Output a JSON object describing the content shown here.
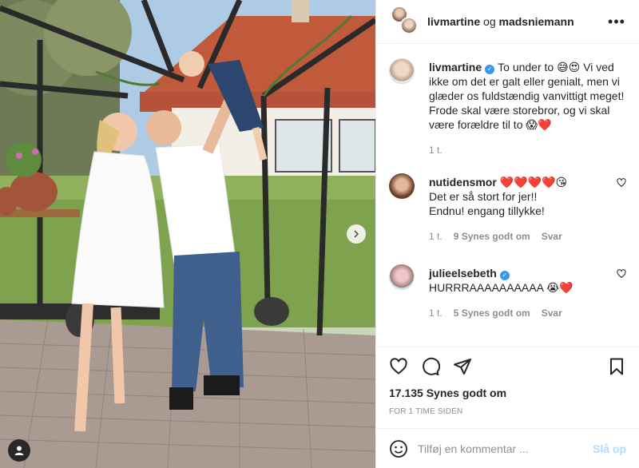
{
  "header": {
    "user1": "livmartine",
    "separator": "og",
    "user2": "madsniemann",
    "more_label": "•••"
  },
  "caption": {
    "username": "livmartine",
    "text": "To under to 😅😍 Vi ved ikke om det er galt eller genialt, men vi glæder os fuldstændig vanvittigt meget! Frode skal være storebror, og vi skal være forældre til to 😱❤️",
    "age": "1 t."
  },
  "comments": [
    {
      "username": "nutidensmor",
      "verified": false,
      "text_line1": "❤️❤️❤️❤️😘",
      "text_line2": "Det er så stort for jer!!",
      "text_line3": "Endnu! engang tillykke!",
      "age": "1 t.",
      "likes": "9 Synes godt om",
      "reply": "Svar"
    },
    {
      "username": "julieelsebeth",
      "verified": true,
      "text": "HURRRAAAAAAAAAA 😭❤️",
      "age": "1 t.",
      "likes": "5 Synes godt om",
      "reply": "Svar"
    }
  ],
  "post": {
    "likes": "17.135 Synes godt om",
    "time": "FOR 1 TIME SIDEN"
  },
  "add_comment": {
    "placeholder": "Tilføj en kommentar ...",
    "post_label": "Slå op"
  },
  "colors": {
    "verified": "#3897f0",
    "post_button_disabled": "#b3dbff",
    "meta_text": "#8e8e8e"
  }
}
